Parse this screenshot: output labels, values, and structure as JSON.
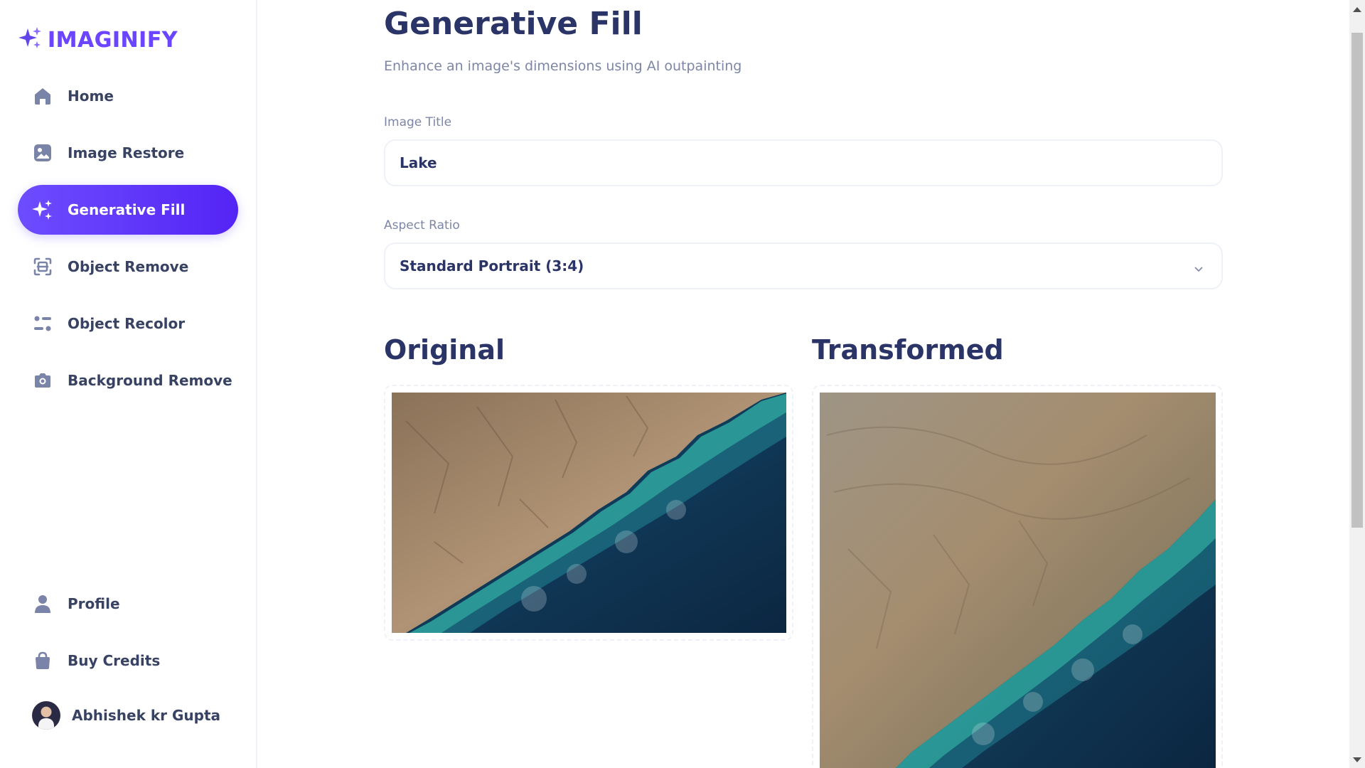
{
  "brand": {
    "name": "IMAGINIFY"
  },
  "sidebar": {
    "items": [
      {
        "label": "Home",
        "icon": "home-icon",
        "active": false
      },
      {
        "label": "Image Restore",
        "icon": "image-icon",
        "active": false
      },
      {
        "label": "Generative Fill",
        "icon": "stars-icon",
        "active": true
      },
      {
        "label": "Object Remove",
        "icon": "scan-icon",
        "active": false
      },
      {
        "label": "Object Recolor",
        "icon": "filter-icon",
        "active": false
      },
      {
        "label": "Background Remove",
        "icon": "camera-icon",
        "active": false
      }
    ],
    "bottom_items": [
      {
        "label": "Profile",
        "icon": "user-icon"
      },
      {
        "label": "Buy Credits",
        "icon": "bag-icon"
      }
    ],
    "user": {
      "name": "Abhishek kr Gupta"
    }
  },
  "page": {
    "title": "Generative Fill",
    "subtitle": "Enhance an image's dimensions using AI outpainting"
  },
  "form": {
    "title_label": "Image Title",
    "title_value": "Lake",
    "aspect_label": "Aspect Ratio",
    "aspect_value": "Standard Portrait (3:4)"
  },
  "preview": {
    "original_label": "Original",
    "transformed_label": "Transformed"
  },
  "colors": {
    "accent": "#6246ea",
    "accent_dark": "#5424f5",
    "heading": "#2b3467",
    "muted": "#7d86a6"
  }
}
